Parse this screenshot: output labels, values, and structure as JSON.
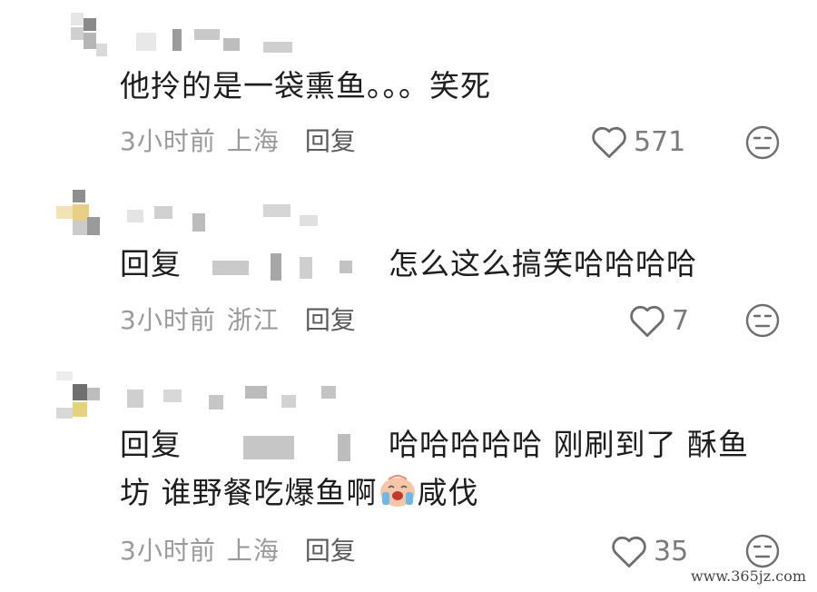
{
  "comments": [
    {
      "text": "他拎的是一袋熏鱼。。。笑死",
      "time": "3小时前",
      "location": "上海",
      "reply_label": "回复",
      "likes": "571"
    },
    {
      "reply_prefix": "回复",
      "text": "怎么这么搞笑哈哈哈哈",
      "time": "3小时前",
      "location": "浙江",
      "reply_label": "回复",
      "likes": "7"
    },
    {
      "reply_prefix": "回复",
      "text_line1": "哈哈哈哈哈 刚刷到了 酥鱼",
      "text_line2_before": "坊 谁野餐吃爆鱼啊",
      "emoji": "crying-face-emoji",
      "text_line2_after": "咸伐",
      "time": "3小时前",
      "location": "上海",
      "reply_label": "回复",
      "likes": "35"
    }
  ],
  "icons": {
    "like": "heart-outline-icon",
    "dislike": "neutral-face-icon"
  },
  "colors": {
    "text": "#1d1d1d",
    "meta": "#9a9a9a",
    "reply": "#5b5b5b",
    "icon": "#6e6e6e"
  },
  "watermark": "www.365jz.com"
}
